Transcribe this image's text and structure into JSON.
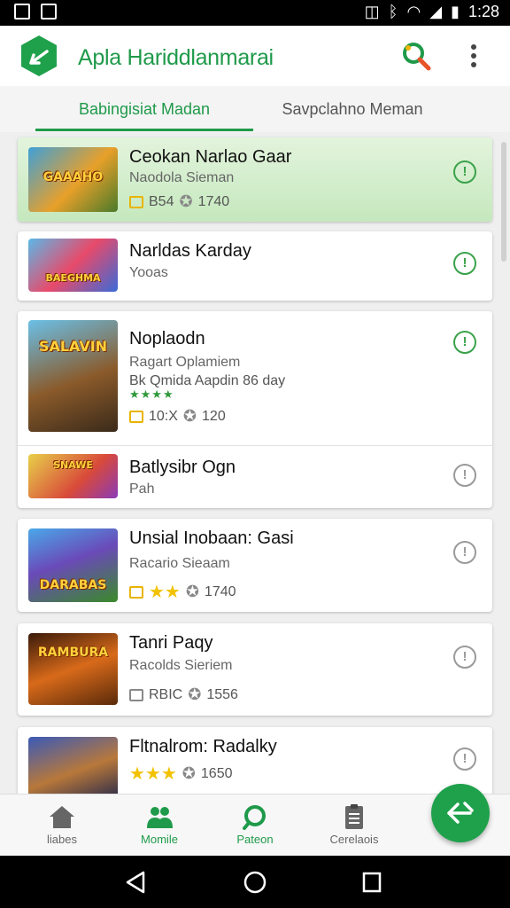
{
  "status_bar": {
    "time": "1:28"
  },
  "app": {
    "title": "Apla Hariddlanmarai",
    "accent": "#1f9a4a"
  },
  "tabs": [
    {
      "label": "Babingisiat Madan",
      "active": true
    },
    {
      "label": "Savpclahno Meman",
      "active": false
    }
  ],
  "items": [
    {
      "title": "Ceokan Narlao Gaar",
      "subtitle": "Naodola Sieman",
      "stat1": "B54",
      "stat2": "1740",
      "thumb_text": "GAAAHO",
      "highlight": true,
      "icon": "info-icon-green"
    },
    {
      "title": "Narldas Karday",
      "subtitle": "Yooas",
      "thumb_text": "BAEGHMA",
      "icon": "info-icon-green"
    },
    {
      "title": "Noplaodn",
      "subtitle": "Ragart Oplamiem",
      "subtitle2": "Bk Qmida Aapdin 86 day",
      "rating_small": "★★★★",
      "stat1": "10:X",
      "stat2": "120",
      "thumb_text": "SALAVIN",
      "icon": "info-icon-green"
    },
    {
      "title": "Batlysibr Ogn",
      "subtitle": "Pah",
      "thumb_text": "SNAWE",
      "icon": "info-icon-grey"
    },
    {
      "title": "Unsial Inobaan: Gasi",
      "subtitle": "Racario Sieaam",
      "stars": "★★",
      "stat2": "1740",
      "thumb_text": "DARABAS",
      "icon": "info-icon-grey"
    },
    {
      "title": "Tanri Paqy",
      "subtitle": "Racolds Sieriem",
      "stat1": "RBIC",
      "stat2": "1556",
      "thumb_text": "RAMBURA",
      "icon": "info-icon-grey"
    },
    {
      "title": "Fltnalrom: Radalky",
      "stars": "★★★",
      "stat2": "1650",
      "thumb_text": "",
      "icon": "info-icon-grey"
    }
  ],
  "bottom_nav": [
    {
      "label": "liabes",
      "icon": "home-icon",
      "active": false
    },
    {
      "label": "Momile",
      "icon": "people-icon",
      "active": true
    },
    {
      "label": "Pateon",
      "icon": "compass-icon",
      "active": true
    },
    {
      "label": "Cerelaois",
      "icon": "clipboard-icon",
      "active": false
    }
  ],
  "fab": {
    "icon": "share-arrow-icon"
  }
}
